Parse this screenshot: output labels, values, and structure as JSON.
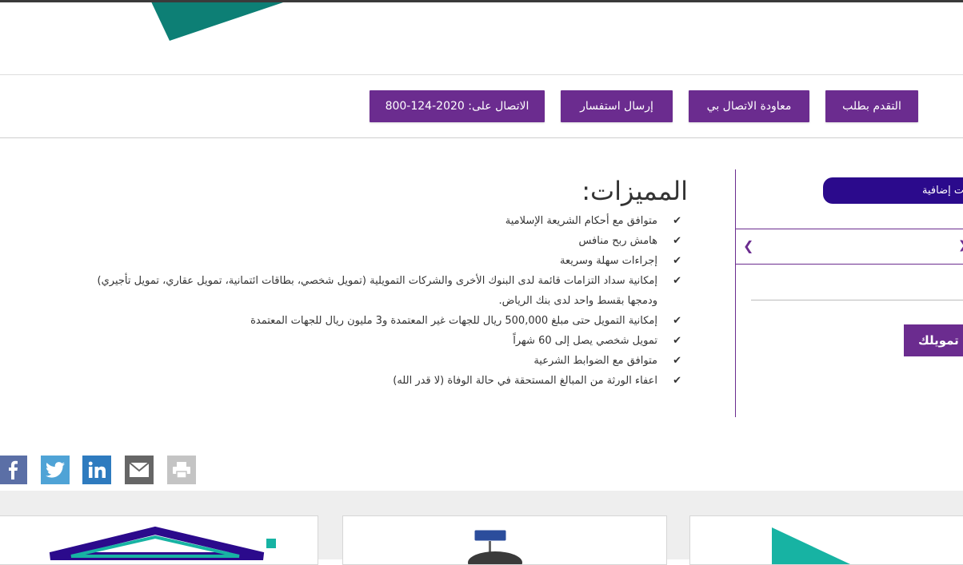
{
  "actions": {
    "apply_label": "التقدم بطلب",
    "callback_label": "معاودة الاتصال بي",
    "inquiry_label": "إرسال استفسار",
    "call_label": "الاتصال على: 2020-124-800"
  },
  "features": {
    "title": "المميزات:",
    "items": [
      "متوافق مع أحكام الشريعة الإسلامية",
      "هامش ربح منافس",
      "إجراءات سهلة وسريعة",
      "إمكانية سداد التزامات قائمة لدى البنوك الأخرى والشركات التمويلية (تمويل شخصي، بطاقات ائتمانية، تمويل عقاري، تمويل تأجيري)",
      "ودمجها بقسط واحد لدى بنك الرياض.",
      "إمكانية التمويل حتى مبلغ 500,000 ريال للجهات غير المعتمدة و3 مليون ريال للجهات المعتمدة",
      "تمويل شخصي يصل إلى 60 شهراً",
      "متوافق مع الضوابط الشرعية",
      "اعفاء الورثة من المبالغ المستحقة في حالة الوفاة (لا قدر الله)"
    ]
  },
  "sidebar": {
    "tab_label": "ت إضافية",
    "cta_label": "تمويلك"
  },
  "colors": {
    "brand_purple": "#6b2c8f",
    "tab_navy": "#2b0a8c",
    "teal": "#0d7f75",
    "facebook": "#5b6fa6",
    "twitter": "#4fa3d6",
    "linkedin": "#2e7bbf",
    "email": "#666666",
    "print": "#bbbbbb"
  },
  "icons": {
    "share": [
      "facebook-icon",
      "twitter-icon",
      "linkedin-icon",
      "email-icon",
      "print-icon"
    ]
  }
}
